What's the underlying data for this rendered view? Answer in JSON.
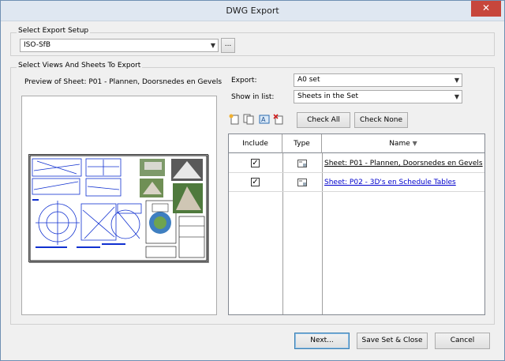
{
  "window": {
    "title": "DWG Export",
    "close_glyph": "✕"
  },
  "setup": {
    "group_label": "Select Export Setup",
    "value": "ISO-SfB",
    "browse_label": "..."
  },
  "views": {
    "group_label": "Select Views And Sheets To Export",
    "preview_label": "Preview of Sheet: P01 - Plannen, Doorsnedes en Gevels",
    "export_label": "Export:",
    "export_value": "A0 set",
    "show_label": "Show in list:",
    "show_value": "Sheets in the Set",
    "check_all": "Check All",
    "check_none": "Check None"
  },
  "table": {
    "headers": {
      "include": "Include",
      "type": "Type",
      "name": "Name"
    },
    "rows": [
      {
        "checked": "✓",
        "name": "Sheet: P01 - Plannen, Doorsnedes en Gevels"
      },
      {
        "checked": "✓",
        "name": "Sheet: P02 - 3D's en Schedule Tables"
      }
    ]
  },
  "footer": {
    "next": "Next...",
    "save_close": "Save Set & Close",
    "cancel": "Cancel"
  },
  "icons": [
    "new-set-icon",
    "duplicate-set-icon",
    "rename-set-icon",
    "delete-set-icon",
    "sheet-icon",
    "sort-descending-icon"
  ],
  "colors": {
    "link": "#0000cc",
    "close": "#c7463c",
    "drawing_blue": "#1030d0"
  }
}
